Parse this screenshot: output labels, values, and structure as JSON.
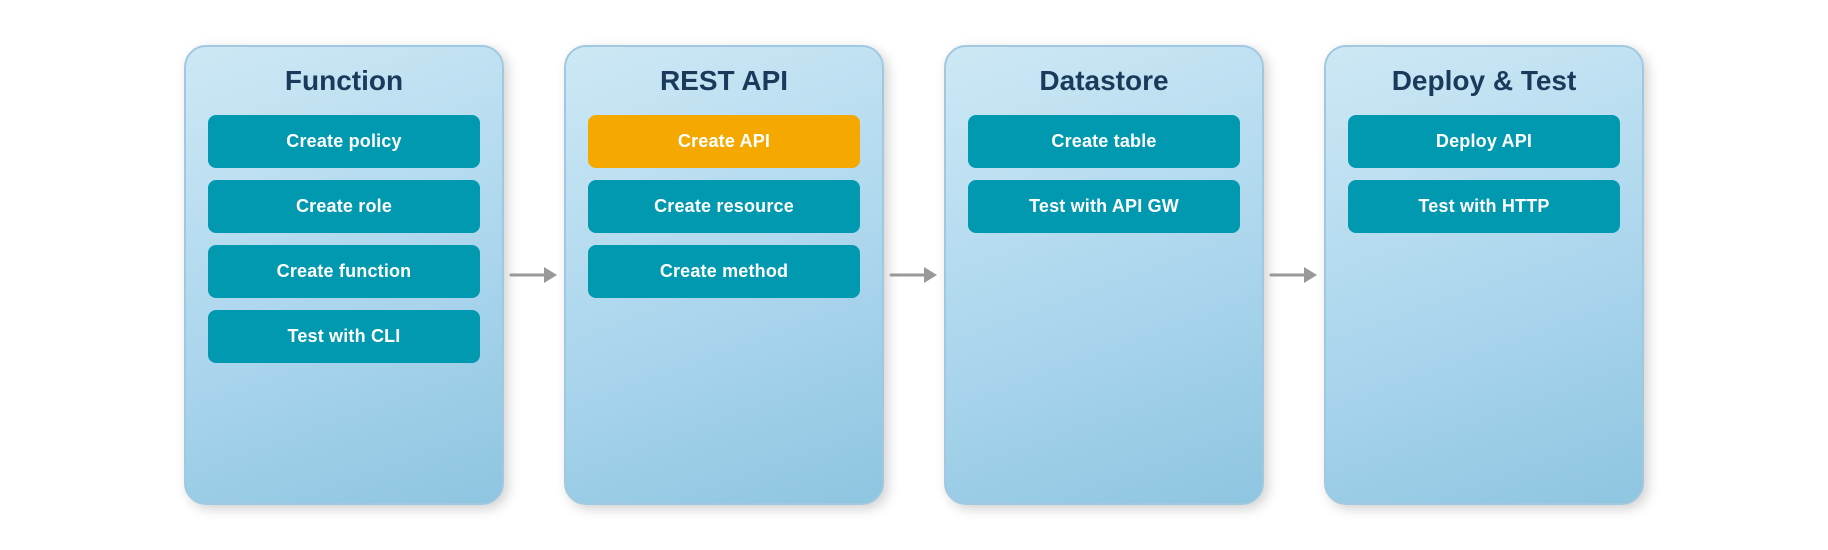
{
  "panels": [
    {
      "id": "function",
      "title": "Function",
      "items": [
        {
          "id": "create-policy",
          "label": "Create policy",
          "active": false
        },
        {
          "id": "create-role",
          "label": "Create role",
          "active": false
        },
        {
          "id": "create-function",
          "label": "Create function",
          "active": false
        },
        {
          "id": "test-with-cli",
          "label": "Test with CLI",
          "active": false
        }
      ]
    },
    {
      "id": "rest-api",
      "title": "REST API",
      "items": [
        {
          "id": "create-api",
          "label": "Create API",
          "active": true
        },
        {
          "id": "create-resource",
          "label": "Create resource",
          "active": false
        },
        {
          "id": "create-method",
          "label": "Create method",
          "active": false
        }
      ]
    },
    {
      "id": "datastore",
      "title": "Datastore",
      "items": [
        {
          "id": "create-table",
          "label": "Create table",
          "active": false
        },
        {
          "id": "test-with-api-gw",
          "label": "Test with API GW",
          "active": false
        }
      ]
    },
    {
      "id": "deploy-test",
      "title": "Deploy & Test",
      "items": [
        {
          "id": "deploy-api",
          "label": "Deploy API",
          "active": false
        },
        {
          "id": "test-with-http",
          "label": "Test with HTTP",
          "active": false
        }
      ]
    }
  ],
  "arrows": [
    {
      "id": "arrow-1"
    },
    {
      "id": "arrow-2"
    },
    {
      "id": "arrow-3"
    }
  ]
}
